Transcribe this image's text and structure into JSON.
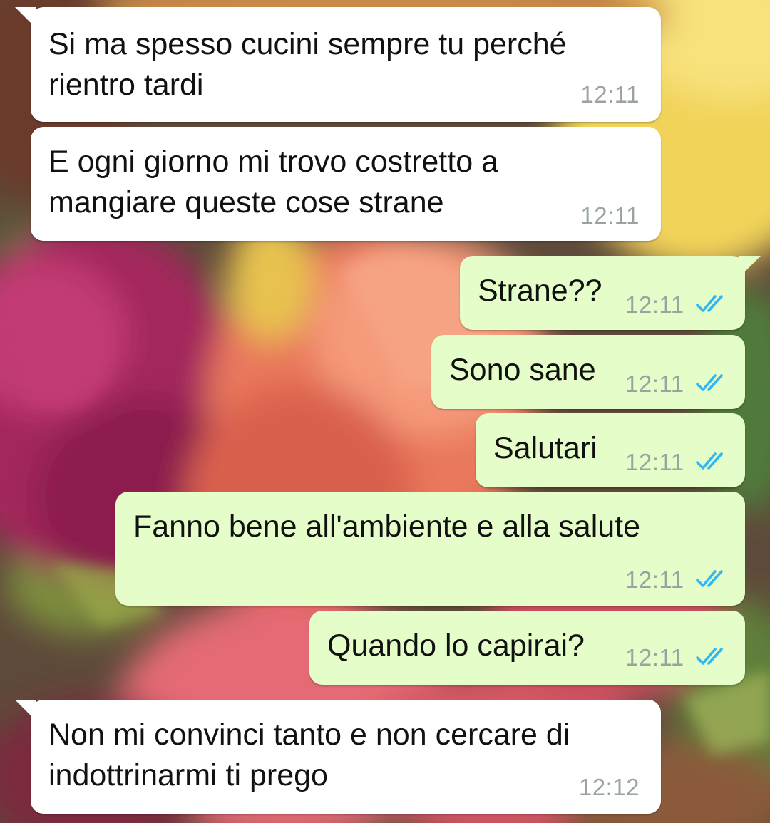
{
  "colors": {
    "incoming_bubble": "#ffffff",
    "outgoing_bubble": "#e4fdc9",
    "message_text": "#111111",
    "timestamp_text": "#9aa3a0",
    "read_ticks": "#34b7f1"
  },
  "messages": [
    {
      "direction": "incoming",
      "text": "Si ma spesso cucini sempre tu perché\nrientro tardi",
      "time": "12:11"
    },
    {
      "direction": "incoming",
      "text": "E ogni giorno mi trovo costretto a\nmangiare queste cose strane",
      "time": "12:11"
    },
    {
      "direction": "outgoing",
      "text": "Strane??",
      "time": "12:11",
      "status": "read"
    },
    {
      "direction": "outgoing",
      "text": "Sono sane",
      "time": "12:11",
      "status": "read"
    },
    {
      "direction": "outgoing",
      "text": "Salutari",
      "time": "12:11",
      "status": "read"
    },
    {
      "direction": "outgoing",
      "text": "Fanno bene all'ambiente e alla salute",
      "time": "12:11",
      "status": "read"
    },
    {
      "direction": "outgoing",
      "text": "Quando lo capirai?",
      "time": "12:11",
      "status": "read"
    },
    {
      "direction": "incoming",
      "text": "Non mi convinci tanto e non cercare di\nindottrinarmi ti prego",
      "time": "12:12"
    }
  ]
}
